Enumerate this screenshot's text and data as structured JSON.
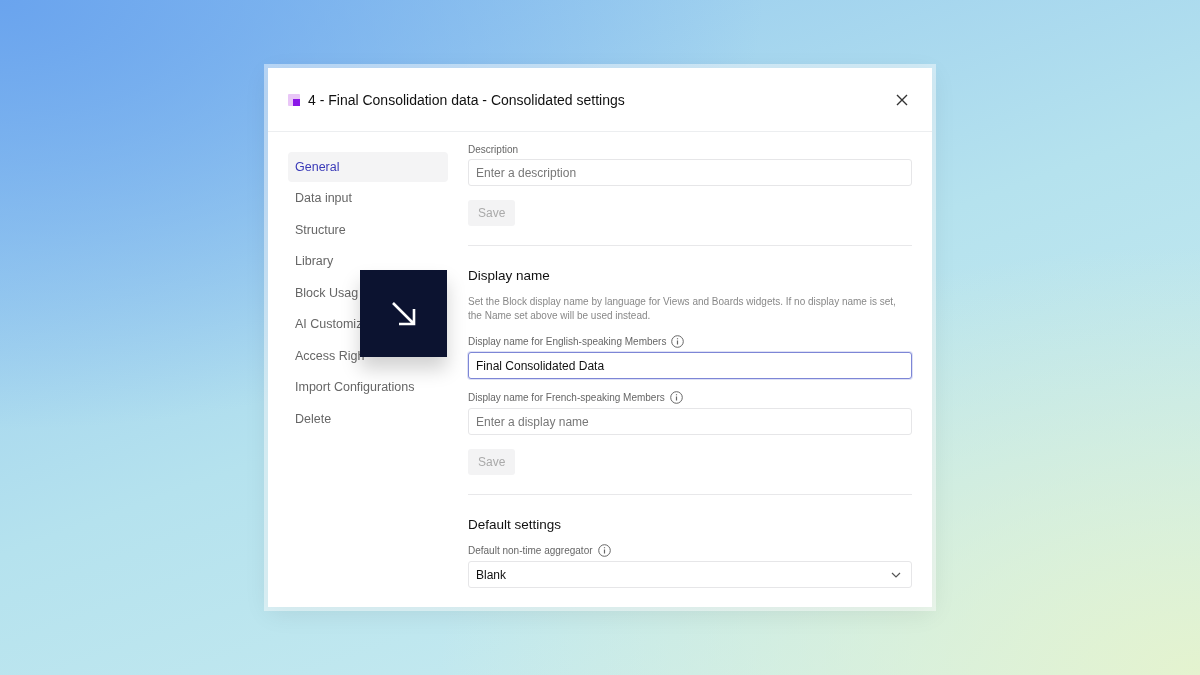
{
  "dialog": {
    "title": "4 - Final Consolidation data - Consolidated settings"
  },
  "sidebar": {
    "items": [
      {
        "label": "General",
        "selected": true
      },
      {
        "label": "Data input",
        "selected": false
      },
      {
        "label": "Structure",
        "selected": false
      },
      {
        "label": "Library",
        "selected": false
      },
      {
        "label": "Block Usag",
        "selected": false
      },
      {
        "label": "AI Customiz",
        "selected": false
      },
      {
        "label": "Access Righ",
        "selected": false
      },
      {
        "label": "Import Configurations",
        "selected": false
      },
      {
        "label": "Delete",
        "selected": false
      }
    ]
  },
  "sections": [
    {
      "fields": [
        {
          "kind": "input",
          "label": "Description",
          "info": false,
          "placeholder": "Enter a description",
          "focused": false
        }
      ],
      "save_button": {
        "label": "Save",
        "disabled": true
      }
    },
    {
      "title": "Display name",
      "description": "Set the Block display name by language for Views and Boards widgets. If no display name is set, the Name set above will be used instead.",
      "fields": [
        {
          "kind": "input",
          "label": "Display name for English-speaking Members",
          "info": true,
          "value": "Final Consolidated Data",
          "focused": true
        },
        {
          "kind": "input",
          "label": "Display name for French-speaking Members",
          "info": true,
          "placeholder": "Enter a display name",
          "focused": false
        }
      ],
      "save_button": {
        "label": "Save",
        "disabled": true
      }
    },
    {
      "title": "Default settings",
      "fields": [
        {
          "kind": "select",
          "label": "Default non-time aggregator",
          "info": true,
          "value": "Blank",
          "focused": false
        }
      ]
    }
  ]
}
